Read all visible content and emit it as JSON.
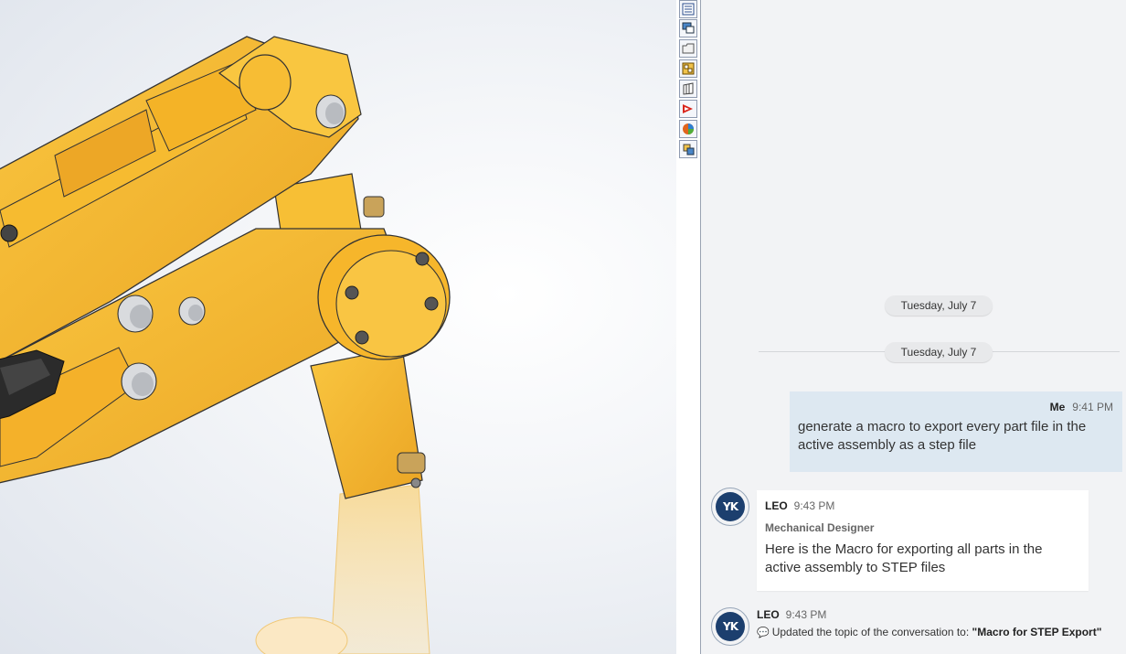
{
  "taskpane": {
    "icons": [
      "resources-icon",
      "forum-icon",
      "file-explorer-icon",
      "view-palette-icon",
      "design-library-icon",
      "solidworks-icon",
      "appearances-icon",
      "custom-properties-icon"
    ]
  },
  "chat": {
    "date_dividers": [
      "Tuesday, July 7",
      "Tuesday, July 7"
    ],
    "messages": [
      {
        "sender": "Me",
        "time": "9:41 PM",
        "text": "generate a macro to export every part file in the active assembly as a step file"
      },
      {
        "sender": "LEO",
        "time": "9:43 PM",
        "role": "Mechanical Designer",
        "text": "Here is the Macro for exporting all parts in the active assembly to STEP files"
      },
      {
        "sender": "LEO",
        "time": "9:43 PM",
        "event_prefix": "Updated the topic of the conversation to:",
        "event_value": "\"Macro for STEP Export\""
      }
    ],
    "avatar_initials": "YK"
  },
  "colors": {
    "part_yellow": "#f5b82e",
    "me_bubble": "#dde8f1",
    "avatar": "#1c3f6e"
  }
}
